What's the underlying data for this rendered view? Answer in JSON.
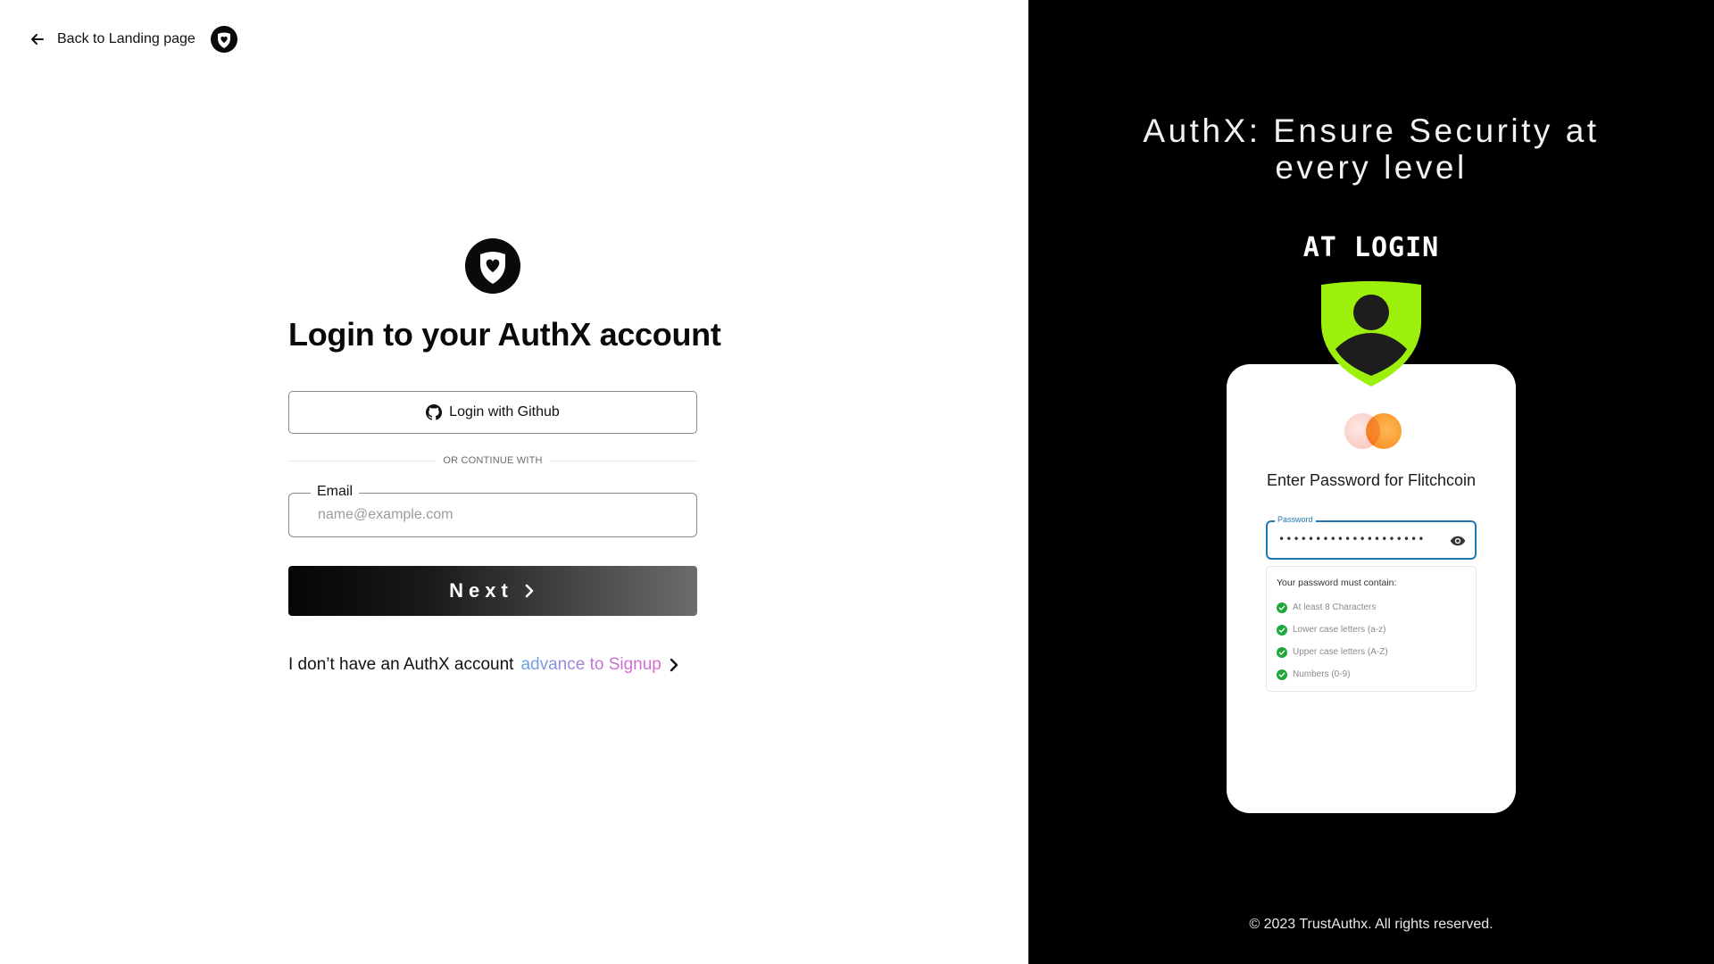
{
  "back_link": {
    "label": "Back to Landing page"
  },
  "login": {
    "title": "Login to your AuthX account",
    "github_button": "Login with Github",
    "divider": "OR CONTINUE WITH",
    "email_label": "Email",
    "email_placeholder": "name@example.com",
    "email_value": "",
    "next_button": "Next",
    "no_account_text": "I don’t have an AuthX account",
    "signup_link": "advance to Signup"
  },
  "promo": {
    "title_line1": "AuthX: Ensure Security at",
    "title_line2": "every level",
    "subtitle": "AT LOGIN",
    "card": {
      "prompt": "Enter Password for Flitchcoin",
      "password_label": "Password",
      "password_value": "••••••••••••••••••••",
      "rules_title": "Your password must contain:",
      "rules": [
        "At least 8 Characters",
        "Lower case letters (a-z)",
        "Upper case letters (A-Z)",
        "Numbers (0-9)"
      ]
    }
  },
  "footer": {
    "copyright": "© 2023 TrustAuthx. All rights reserved."
  },
  "colors": {
    "accent_green": "#9cf00b",
    "focus_blue": "#1f77b4",
    "check_green": "#1fa83a",
    "dark_panel": "#000000",
    "signup_gradient_start": "#5ea7e6",
    "signup_gradient_end": "#d96ad0"
  },
  "icons": {
    "back": "arrow-left-icon",
    "logo": "shield-heart-logo",
    "github": "github-icon",
    "chevron": "chevron-right-icon",
    "eye": "eye-icon",
    "check": "check-circle-icon",
    "user_shield": "user-shield-icon"
  }
}
